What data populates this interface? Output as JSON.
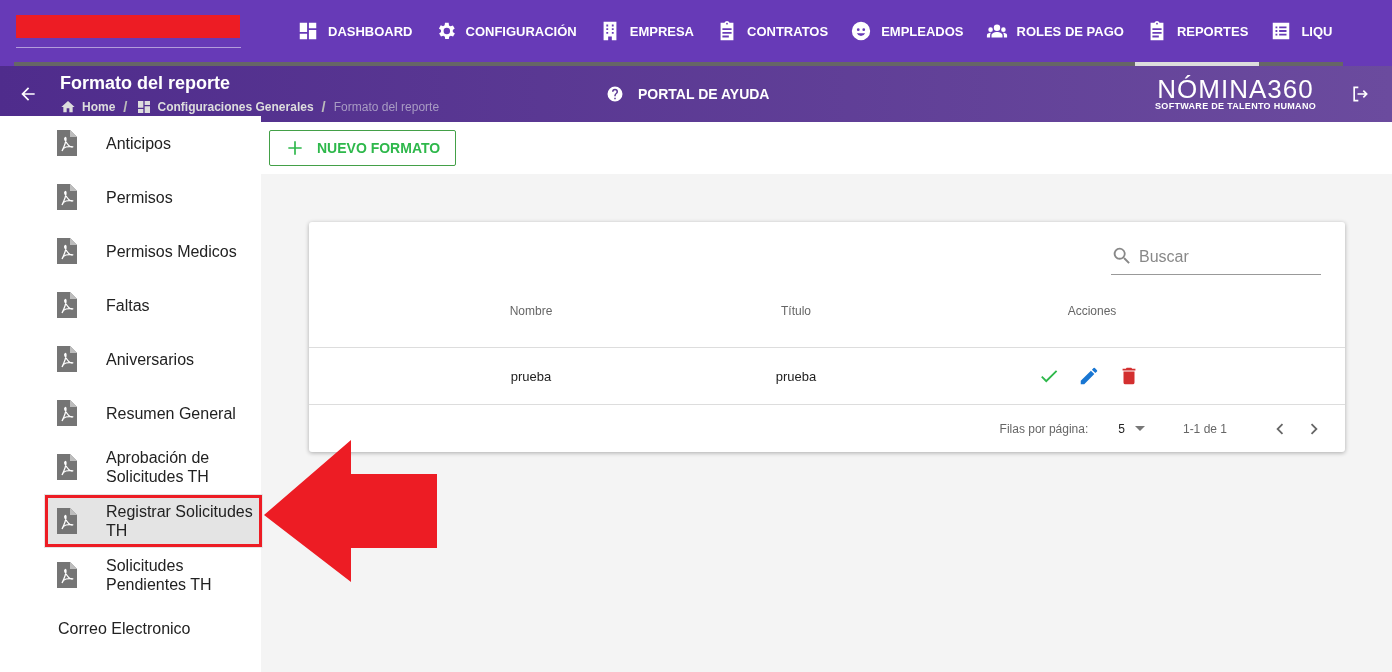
{
  "nav": [
    {
      "label": "DASHBOARD",
      "selected": false
    },
    {
      "label": "CONFIGURACIÓN",
      "selected": false
    },
    {
      "label": "EMPRESA",
      "selected": false
    },
    {
      "label": "CONTRATOS",
      "selected": false
    },
    {
      "label": "EMPLEADOS",
      "selected": false
    },
    {
      "label": "ROLES DE PAGO",
      "selected": false
    },
    {
      "label": "REPORTES",
      "selected": true
    },
    {
      "label": "LIQU",
      "selected": false
    }
  ],
  "page_header": {
    "title": "Formato del reporte",
    "breadcrumbs": [
      "Home",
      "Configuraciones Generales",
      "Formato del reporte"
    ],
    "breadcrumb_separator": "/",
    "help_link": "PORTAL DE AYUDA",
    "logo_main": "NÓMINA360",
    "logo_sub": "SOFTWARE DE TALENTO HUMANO"
  },
  "sidebar": {
    "items": [
      {
        "label": "Anticipos",
        "kind": "pdf",
        "selected": false
      },
      {
        "label": "Permisos",
        "kind": "pdf",
        "selected": false
      },
      {
        "label": "Permisos Medicos",
        "kind": "pdf",
        "selected": false
      },
      {
        "label": "Faltas",
        "kind": "pdf",
        "selected": false
      },
      {
        "label": "Aniversarios",
        "kind": "pdf",
        "selected": false
      },
      {
        "label": "Resumen General",
        "kind": "pdf",
        "selected": false
      },
      {
        "label": "Aprobación de Solicitudes TH",
        "kind": "pdf",
        "selected": false
      },
      {
        "label": "Registrar Solicitudes TH",
        "kind": "pdf",
        "selected": true
      },
      {
        "label": "Solicitudes Pendientes TH",
        "kind": "pdf",
        "selected": false
      },
      {
        "label": "Correo Electronico",
        "kind": "plain",
        "selected": false
      }
    ]
  },
  "new_button": "NUEVO FORMATO",
  "table": {
    "search_placeholder": "Buscar",
    "columns": [
      "Nombre",
      "Título",
      "Acciones"
    ],
    "rows": [
      {
        "nombre": "prueba",
        "titulo": "prueba"
      }
    ],
    "rows_per_page_label": "Filas por página:",
    "rows_per_page": "5",
    "range": "1-1 de 1"
  }
}
